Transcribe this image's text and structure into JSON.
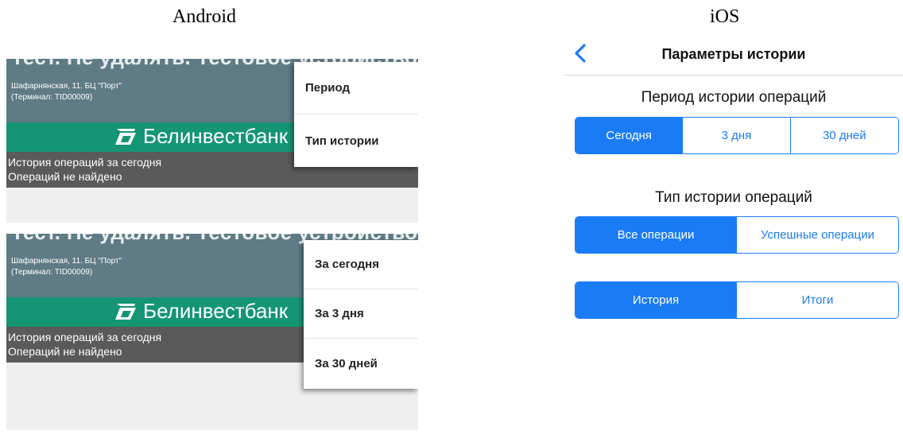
{
  "captions": {
    "android": "Android",
    "ios": "iOS"
  },
  "android": {
    "header_cut_text": "Тест. Не удалять. Тестовое устройство",
    "address_line1": "Шафарнянская, 11. БЦ \"Порт\"",
    "address_line2": "(Терминал: TID00009)",
    "brand_name": "Белинвестбанк",
    "info_line1": "История операций за сегодня",
    "info_line2": "Операций не найдено",
    "menu_main": [
      "Период",
      "Тип истории"
    ],
    "menu_period": [
      "За сегодня",
      "За 3 дня",
      "За 30 дней"
    ]
  },
  "ios": {
    "nav_title": "Параметры истории",
    "period_title": "Период истории операций",
    "period_options": [
      "Сегодня",
      "3 дня",
      "30 дней"
    ],
    "period_selected": "Сегодня",
    "type_title": "Тип истории операций",
    "type_options": [
      "Все операции",
      "Успешные операции"
    ],
    "type_selected": "Все операции",
    "view_options": [
      "История",
      "Итоги"
    ],
    "view_selected": "История"
  },
  "colors": {
    "ios_accent": "#1a7cf5",
    "android_header": "#5f7b85",
    "android_brand": "#149574",
    "android_info": "#5a5a5a"
  }
}
